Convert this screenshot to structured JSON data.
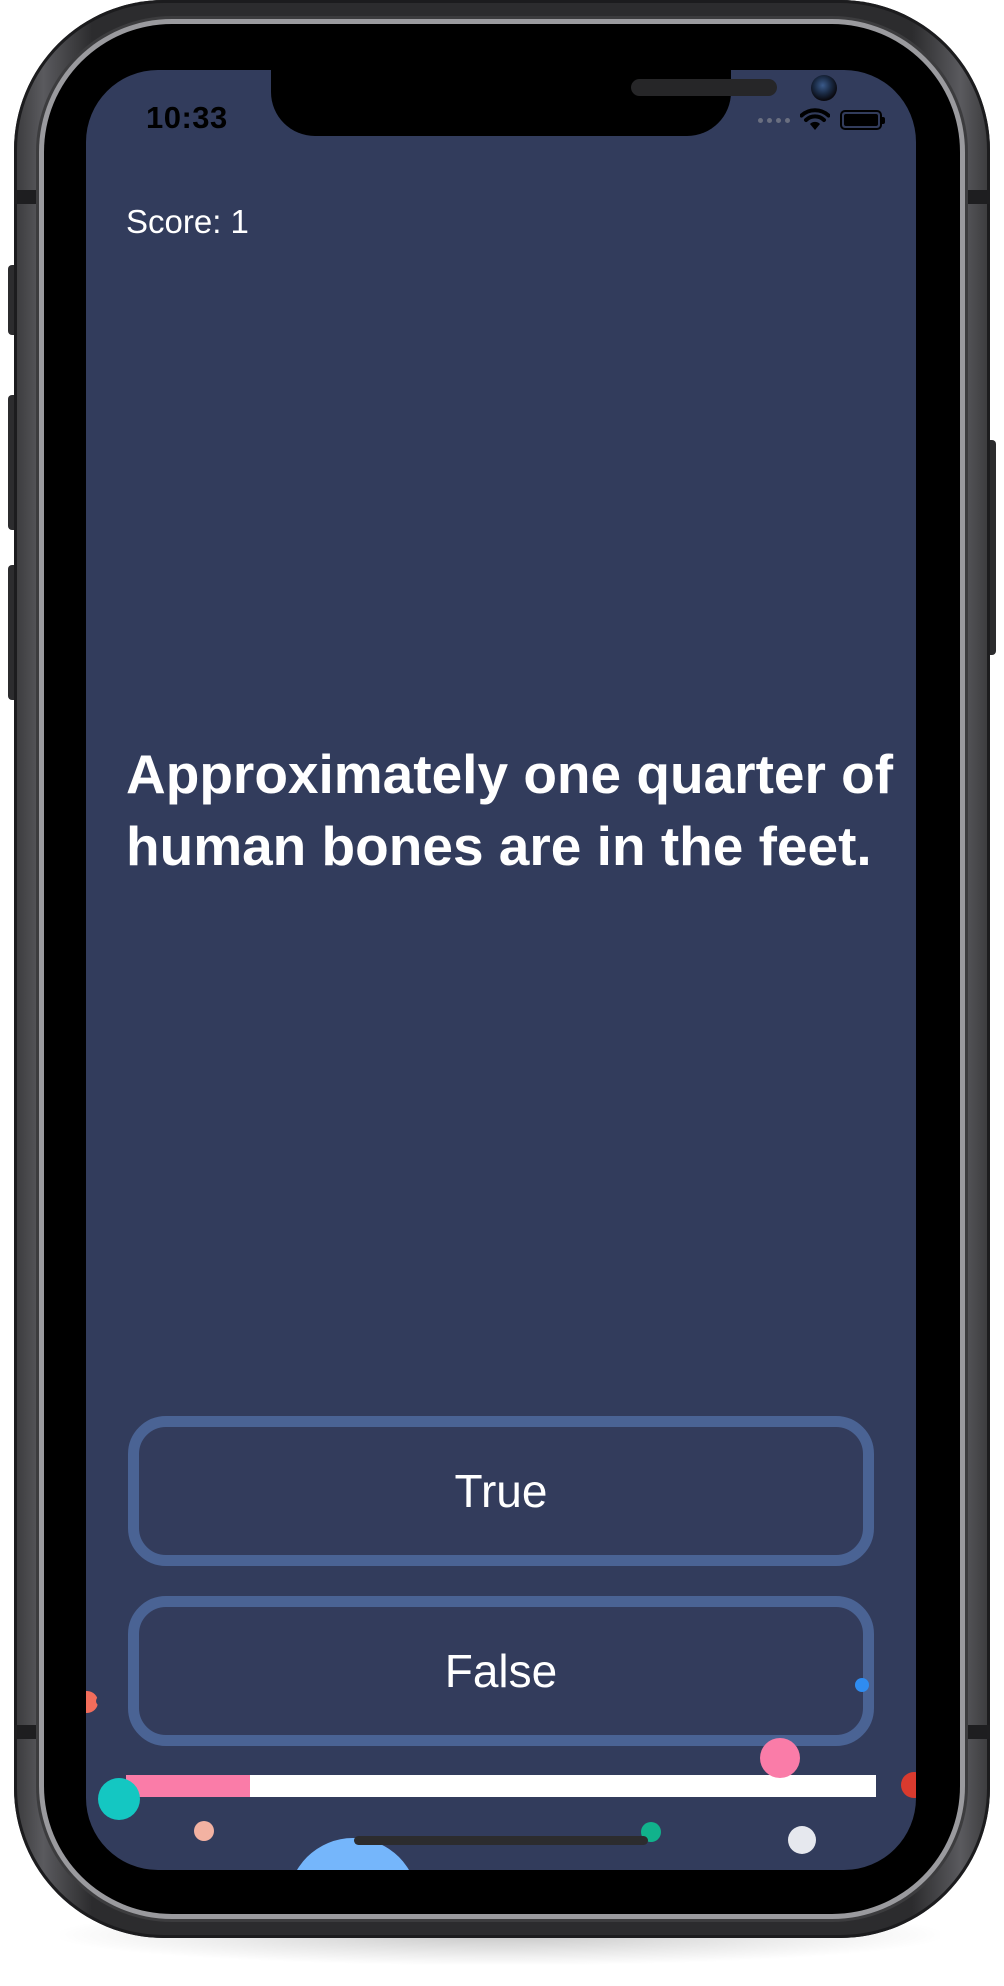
{
  "status_bar": {
    "time": "10:33"
  },
  "quiz": {
    "score_label": "Score: 1",
    "question": "Approximately one quarter of human bones are in the feet.",
    "answers": {
      "true_label": "True",
      "false_label": "False"
    },
    "progress": 0.165
  },
  "colors": {
    "background": "#323c5c",
    "button_border": "#4a6394",
    "progress_fill": "#fa7ca8",
    "progress_track": "#ffffff",
    "text": "#ffffff"
  },
  "icons": {
    "wifi": "wifi-icon",
    "battery": "battery-icon",
    "signal": "signal-icon"
  }
}
